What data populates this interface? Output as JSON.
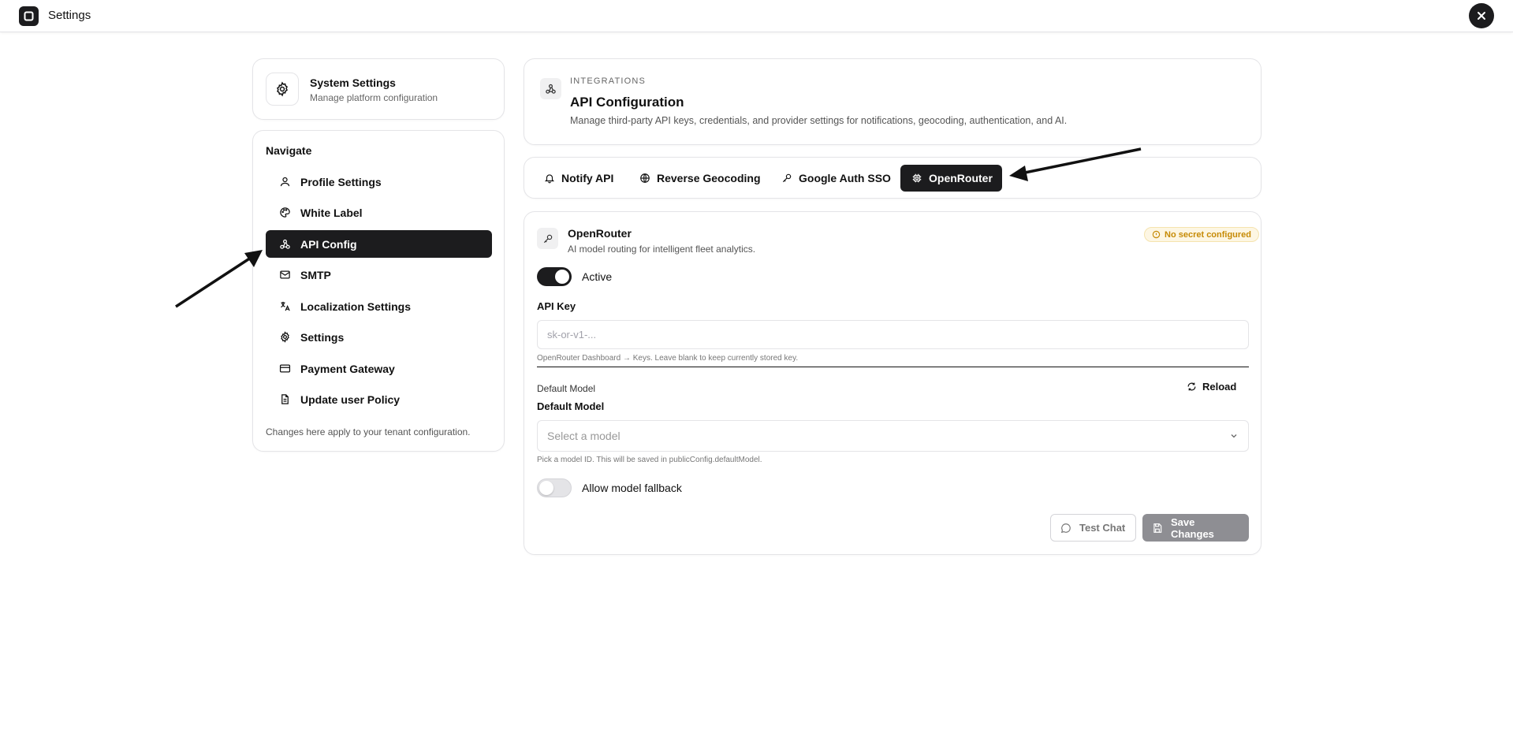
{
  "topbar": {
    "title": "Settings"
  },
  "system": {
    "title": "System Settings",
    "subtitle": "Manage platform configuration"
  },
  "nav": {
    "heading": "Navigate",
    "items": [
      {
        "label": "Profile Settings",
        "icon": "user-icon"
      },
      {
        "label": "White Label",
        "icon": "palette-icon"
      },
      {
        "label": "API Config",
        "icon": "webhook-icon",
        "active": true
      },
      {
        "label": "SMTP",
        "icon": "mail-icon"
      },
      {
        "label": "Localization Settings",
        "icon": "languages-icon"
      },
      {
        "label": "Settings",
        "icon": "gear-icon"
      },
      {
        "label": "Payment Gateway",
        "icon": "credit-card-icon"
      },
      {
        "label": "Update user Policy",
        "icon": "document-icon"
      }
    ],
    "footer": "Changes here apply to your tenant configuration."
  },
  "integrations": {
    "eyebrow": "INTEGRATIONS",
    "title": "API Configuration",
    "description": "Manage third-party API keys, credentials, and provider settings for notifications, geocoding, authentication, and AI."
  },
  "tabs": [
    {
      "label": "Notify API",
      "icon": "bell-icon"
    },
    {
      "label": "Reverse Geocoding",
      "icon": "globe-icon"
    },
    {
      "label": "Google Auth SSO",
      "icon": "key-icon"
    },
    {
      "label": "OpenRouter",
      "icon": "cpu-icon",
      "active": true
    }
  ],
  "openrouter": {
    "title": "OpenRouter",
    "subtitle": "AI model routing for intelligent fleet analytics.",
    "badge": "No secret configured",
    "active_label": "Active",
    "active": true,
    "api_key_label": "API Key",
    "api_key_value": "",
    "api_key_placeholder": "sk-or-v1-...",
    "api_key_hint": "OpenRouter Dashboard → Keys. Leave blank to keep currently stored key.",
    "default_model_small": "Default Model",
    "default_model_label": "Default Model",
    "reload_label": "Reload",
    "model_placeholder": "Select a model",
    "model_hint": "Pick a model ID. This will be saved in publicConfig.defaultModel.",
    "fallback_label": "Allow model fallback",
    "fallback": false,
    "test_chat_label": "Test Chat",
    "save_label": "Save Changes"
  },
  "colors": {
    "primary": "#1c1c1e",
    "warning": "#c68a05",
    "disabled": "#8e8e93"
  }
}
